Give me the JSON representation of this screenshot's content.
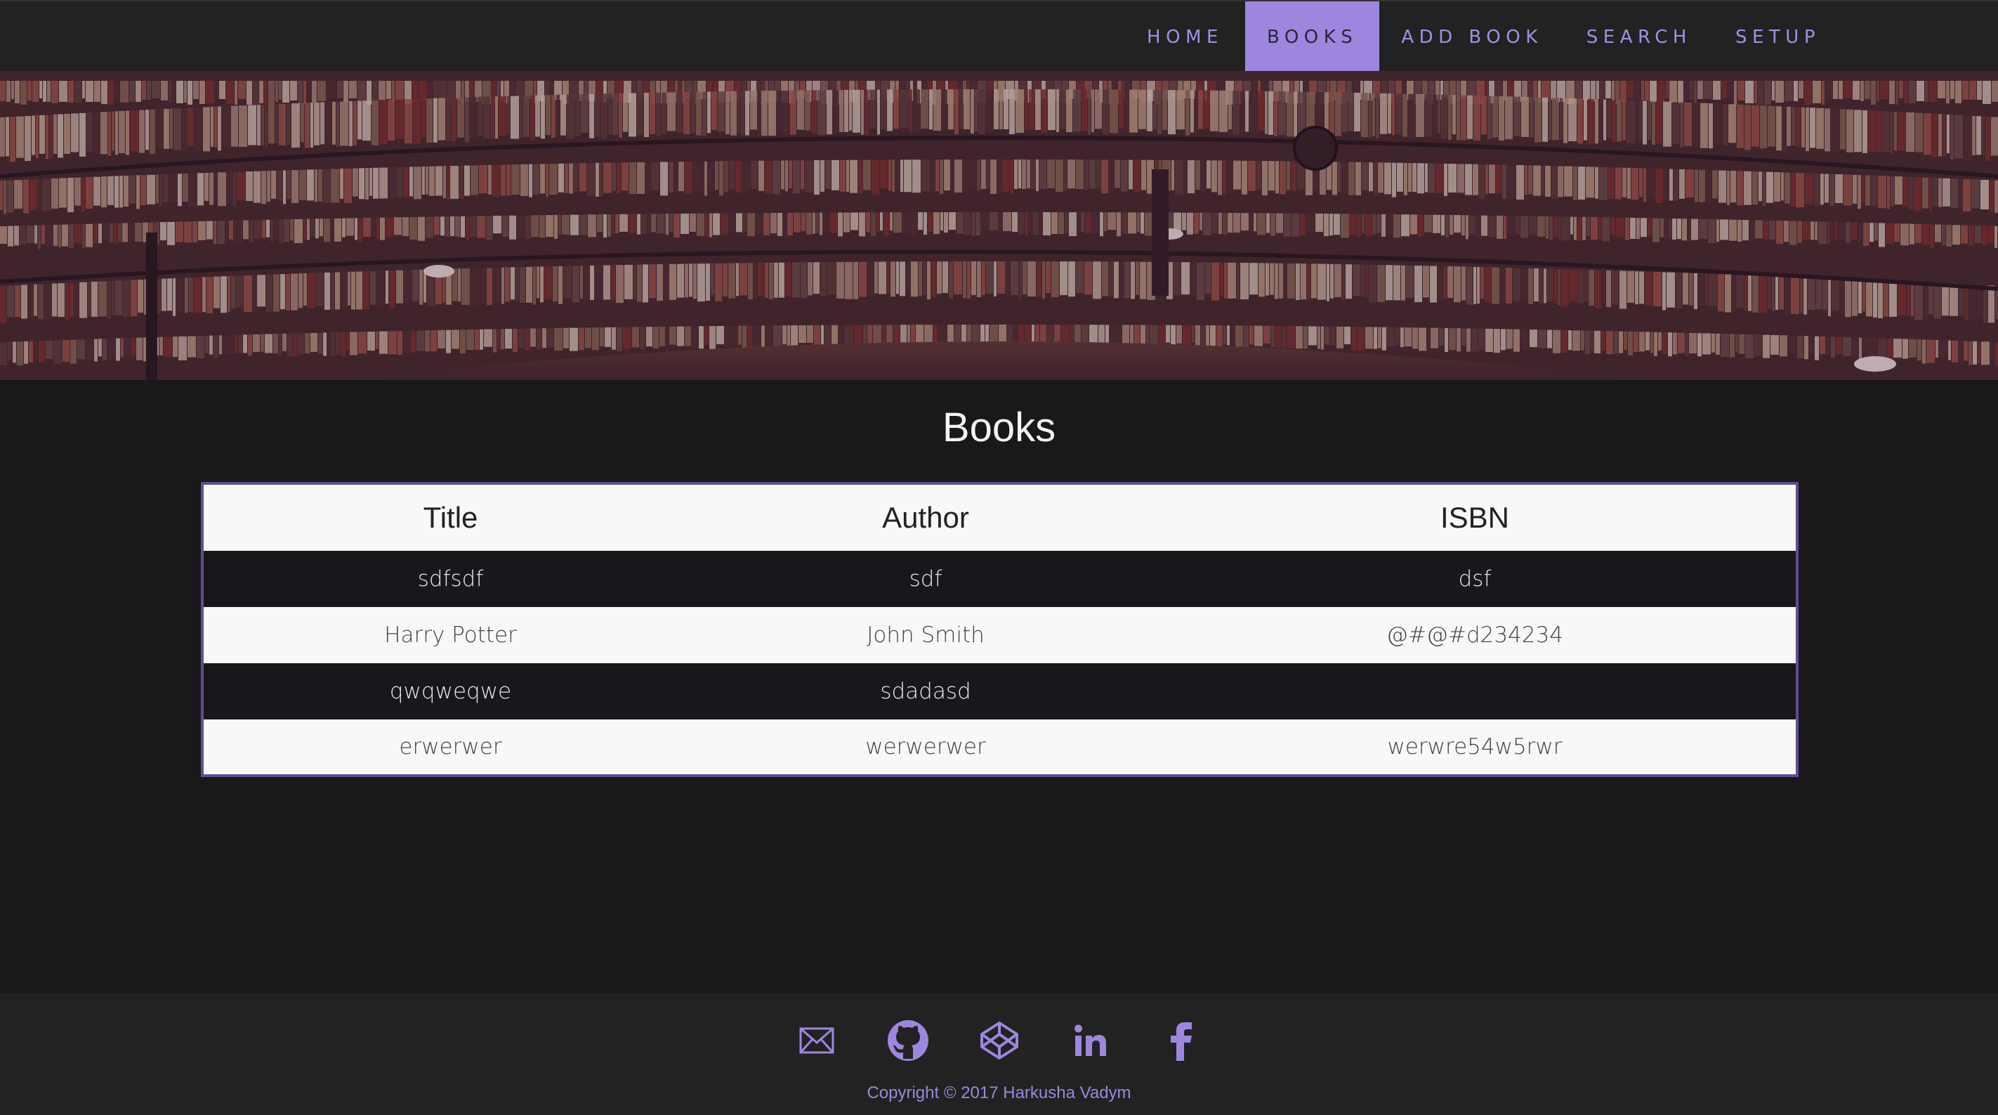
{
  "nav": {
    "items": [
      {
        "label": "HOME",
        "active": false
      },
      {
        "label": "BOOKS",
        "active": true
      },
      {
        "label": "ADD BOOK",
        "active": false
      },
      {
        "label": "SEARCH",
        "active": false
      },
      {
        "label": "SETUP",
        "active": false
      }
    ]
  },
  "hero": {
    "image": "library-bookshelves-panorama"
  },
  "main": {
    "title": "Books",
    "table": {
      "headers": [
        "Title",
        "Author",
        "ISBN"
      ],
      "rows": [
        {
          "title": "sdfsdf",
          "author": "sdf",
          "isbn": "dsf"
        },
        {
          "title": "Harry Potter",
          "author": "John Smith",
          "isbn": "@#@#d234234"
        },
        {
          "title": "qwqweqwe",
          "author": "sdadasd",
          "isbn": ""
        },
        {
          "title": "erwerwer",
          "author": "werwerwer",
          "isbn": "werwre54w5rwr"
        }
      ]
    }
  },
  "footer": {
    "icons": [
      "mail-icon",
      "github-icon",
      "codepen-icon",
      "linkedin-icon",
      "facebook-icon"
    ],
    "copyright": "Copyright © 2017 Harkusha Vadym"
  },
  "colors": {
    "accent": "#9d87de",
    "nav_background": "#222222",
    "page_background": "#1a181b",
    "table_border": "#5f4f93"
  }
}
